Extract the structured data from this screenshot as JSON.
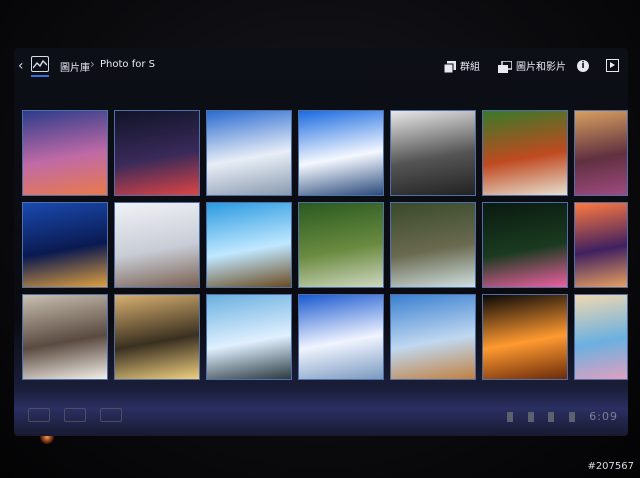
{
  "action_bar": {
    "breadcrumb_root": "圖片庫",
    "breadcrumb_current": "Photo for S",
    "group_label": "群組",
    "media_label": "圖片和影片"
  },
  "navbar": {
    "clock": "6:09"
  },
  "watermark": "#207567",
  "thumbnails": [
    {
      "name": "sunset-coast",
      "row": 0,
      "col": 0,
      "colors": [
        "#2c3c8a",
        "#c06aa6",
        "#e87a4a"
      ]
    },
    {
      "name": "bridge-night-arch",
      "row": 0,
      "col": 1,
      "colors": [
        "#101428",
        "#3a2a5a",
        "#d44"
      ]
    },
    {
      "name": "hotel-building",
      "row": 0,
      "col": 2,
      "colors": [
        "#2a6bd0",
        "#e8eef6",
        "#8a9ab0"
      ]
    },
    {
      "name": "tower-blue-sky",
      "row": 0,
      "col": 3,
      "colors": [
        "#1a6be0",
        "#f4f8ff",
        "#2a4a7a"
      ]
    },
    {
      "name": "cyclist-bridge",
      "row": 0,
      "col": 4,
      "colors": [
        "#e8e8e8",
        "#555",
        "#222"
      ]
    },
    {
      "name": "motocross-rider",
      "row": 0,
      "col": 5,
      "colors": [
        "#3a7a2a",
        "#c04a20",
        "#e6e0d0"
      ]
    },
    {
      "name": "field-sunset",
      "row": 0,
      "col": 6,
      "colors": [
        "#d8a060",
        "#603040",
        "#a04a80"
      ]
    },
    {
      "name": "night-harbor-lights",
      "row": 1,
      "col": 0,
      "colors": [
        "#1a4ab0",
        "#0a1a50",
        "#e0a040"
      ]
    },
    {
      "name": "child-in-water",
      "row": 1,
      "col": 1,
      "colors": [
        "#f0f2f6",
        "#c8ccd6",
        "#7a6050"
      ]
    },
    {
      "name": "pier-wooden",
      "row": 1,
      "col": 2,
      "colors": [
        "#2a9ae0",
        "#c0e8ff",
        "#6a4a20"
      ]
    },
    {
      "name": "forest-hut",
      "row": 1,
      "col": 3,
      "colors": [
        "#2a5a20",
        "#6a8a40",
        "#d0d8c0"
      ]
    },
    {
      "name": "waterfall-rocks",
      "row": 1,
      "col": 4,
      "colors": [
        "#3a4a2a",
        "#6a6a50",
        "#d0e0e0"
      ]
    },
    {
      "name": "pink-flower-dark",
      "row": 1,
      "col": 5,
      "colors": [
        "#0a1a10",
        "#1a3a20",
        "#f060a0"
      ]
    },
    {
      "name": "city-sunset-tower",
      "row": 1,
      "col": 6,
      "colors": [
        "#ff7a40",
        "#402060",
        "#e8a060"
      ]
    },
    {
      "name": "woman-reflection",
      "row": 2,
      "col": 0,
      "colors": [
        "#c8c0b0",
        "#5a4a40",
        "#f4f0e8"
      ]
    },
    {
      "name": "beach-sunset",
      "row": 2,
      "col": 1,
      "colors": [
        "#d8b070",
        "#3a3020",
        "#f0d080"
      ]
    },
    {
      "name": "lighthouse-shore",
      "row": 2,
      "col": 2,
      "colors": [
        "#6ab0e0",
        "#e0f0ff",
        "#2a3a40"
      ]
    },
    {
      "name": "arch-bridge-blue",
      "row": 2,
      "col": 3,
      "colors": [
        "#1a5ad0",
        "#f0f4ff",
        "#7a9ac0"
      ]
    },
    {
      "name": "lake-mountain",
      "row": 2,
      "col": 4,
      "colors": [
        "#3a80d0",
        "#c0d8f0",
        "#c08040"
      ]
    },
    {
      "name": "sky-lanterns",
      "row": 2,
      "col": 5,
      "colors": [
        "#0a0808",
        "#ff9a30",
        "#6a2a0a"
      ]
    },
    {
      "name": "anime-character",
      "row": 2,
      "col": 6,
      "colors": [
        "#f0d8b0",
        "#6ab0e0",
        "#e0a0c0"
      ]
    }
  ]
}
